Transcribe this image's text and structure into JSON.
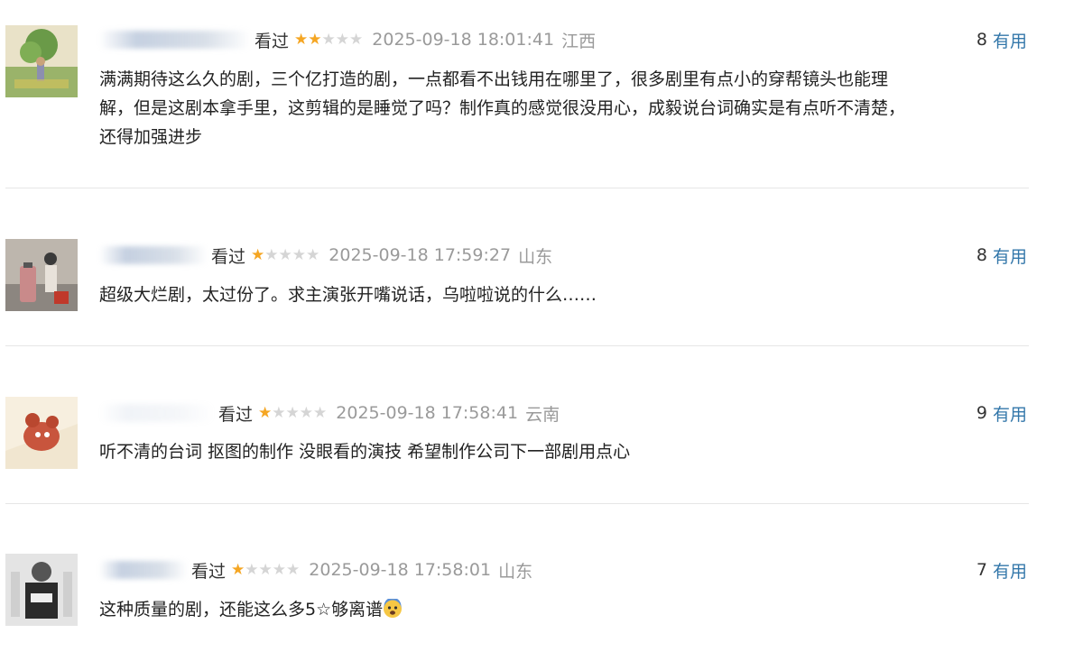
{
  "comments": [
    {
      "username": "T东OiTR7Vk0c",
      "watched": "看过",
      "stars_on": 2,
      "stars_total": 5,
      "time": "2025-09-18 18:01:41",
      "location": "江西",
      "count": "8",
      "useful": "有用",
      "line1": "满满期待这么久的剧，三个亿打造的剧，一点都看不出钱用在哪里了，很多剧里有点小的穿帮镜头也能理",
      "line2": "解，但是这剧本拿手里，这剪辑的是睡觉了吗？制作真的感觉很没用心，成毅说台词确实是有点听不清楚，",
      "line3": "还得加强进步"
    },
    {
      "watched": "看过",
      "stars_on": 1,
      "stars_total": 5,
      "time": "2025-09-18 17:59:27",
      "location": "山东",
      "count": "8",
      "useful": "有用",
      "line1": "超级大烂剧，太过份了。求主演张开嘴说话，乌啦啦说的什么……"
    },
    {
      "watched": "看过",
      "stars_on": 1,
      "stars_total": 5,
      "time": "2025-09-18 17:58:41",
      "location": "云南",
      "count": "9",
      "useful": "有用",
      "line1": "听不清的台词 抠图的制作 没眼看的演技 希望制作公司下一部剧用点心"
    },
    {
      "watched": "看过",
      "stars_on": 1,
      "stars_total": 5,
      "time": "2025-09-18 17:58:01",
      "location": "山东",
      "count": "7",
      "useful": "有用",
      "line1": "这种质量的剧，还能这么多5☆够离谱"
    }
  ],
  "colors": {
    "star_on": "#f5a623",
    "star_off": "#d5d5d5",
    "useful_link": "#3377aa",
    "meta_gray": "#9a9a9a"
  },
  "icons": [
    "star-icon",
    "scared-face-emoji"
  ]
}
